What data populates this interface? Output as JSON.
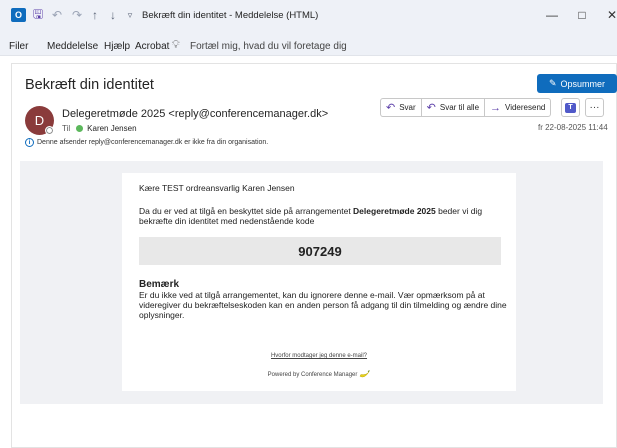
{
  "window": {
    "title": "Bekræft din identitet - Meddelelse (HTML)",
    "icons": [
      "outlook-icon",
      "save-icon",
      "undo-icon",
      "redo-icon",
      "up-icon",
      "down-icon",
      "customize-qat-icon"
    ],
    "controls": {
      "minimize": "—",
      "maximize": "□",
      "close": "✕"
    }
  },
  "menu": {
    "items": [
      "Filer",
      "Meddelelse",
      "Hjælp",
      "Acrobat"
    ],
    "tell_me": "Fortæl mig, hvad du vil foretage dig"
  },
  "message": {
    "subject": "Bekræft din identitet",
    "summarize_label": "Opsummer",
    "avatar_initial": "D",
    "sender": "Delegeretmøde 2025 <reply@conferencemanager.dk>",
    "to_label": "Til",
    "to_name": "Karen Jensen",
    "actions": {
      "reply": "Svar",
      "reply_all": "Svar til alle",
      "forward": "Videresend"
    },
    "date": "fr 22-08-2025 11:44",
    "external_notice": "Denne afsender reply@conferencemanager.dk er ikke fra din organisation."
  },
  "email": {
    "greeting": "Kære TEST ordreansvarlig Karen Jensen",
    "intro_pre": "Da du er ved at tilgå en beskyttet side på arrangementet ",
    "intro_event": "Delegeretmøde 2025",
    "intro_post": " beder vi dig bekræfte din identitet med nedenstående kode",
    "code": "907249",
    "note_title": "Bemærk",
    "note_text": "Er du ikke ved at tilgå arrangementet, kan du ignorere denne e-mail. Vær opmærksom på at videregiver du bekræftelseskoden kan en anden person få adgang til din tilmelding og ændre dine oplysninger.",
    "why_link": "Hvorfor modtager jeg denne e-mail?",
    "powered_by": "Powered by Conference Manager"
  },
  "colors": {
    "accent": "#0f6cbd",
    "avatar": "#8a3b3b",
    "email_bg": "#f0f1f4",
    "code_bg": "#e8e8e8",
    "presence": "#5cb85c"
  }
}
